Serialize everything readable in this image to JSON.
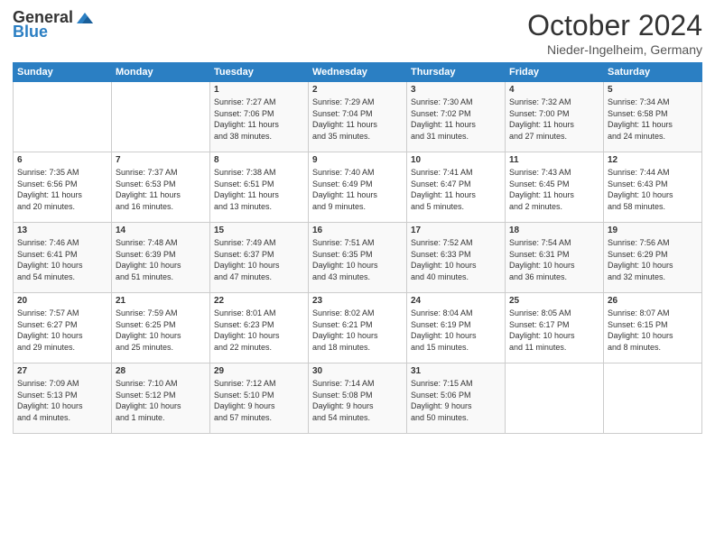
{
  "header": {
    "logo_general": "General",
    "logo_blue": "Blue",
    "month_title": "October 2024",
    "location": "Nieder-Ingelheim, Germany"
  },
  "days_of_week": [
    "Sunday",
    "Monday",
    "Tuesday",
    "Wednesday",
    "Thursday",
    "Friday",
    "Saturday"
  ],
  "weeks": [
    {
      "days": [
        {
          "num": "",
          "detail": ""
        },
        {
          "num": "",
          "detail": ""
        },
        {
          "num": "1",
          "detail": "Sunrise: 7:27 AM\nSunset: 7:06 PM\nDaylight: 11 hours\nand 38 minutes."
        },
        {
          "num": "2",
          "detail": "Sunrise: 7:29 AM\nSunset: 7:04 PM\nDaylight: 11 hours\nand 35 minutes."
        },
        {
          "num": "3",
          "detail": "Sunrise: 7:30 AM\nSunset: 7:02 PM\nDaylight: 11 hours\nand 31 minutes."
        },
        {
          "num": "4",
          "detail": "Sunrise: 7:32 AM\nSunset: 7:00 PM\nDaylight: 11 hours\nand 27 minutes."
        },
        {
          "num": "5",
          "detail": "Sunrise: 7:34 AM\nSunset: 6:58 PM\nDaylight: 11 hours\nand 24 minutes."
        }
      ]
    },
    {
      "days": [
        {
          "num": "6",
          "detail": "Sunrise: 7:35 AM\nSunset: 6:56 PM\nDaylight: 11 hours\nand 20 minutes."
        },
        {
          "num": "7",
          "detail": "Sunrise: 7:37 AM\nSunset: 6:53 PM\nDaylight: 11 hours\nand 16 minutes."
        },
        {
          "num": "8",
          "detail": "Sunrise: 7:38 AM\nSunset: 6:51 PM\nDaylight: 11 hours\nand 13 minutes."
        },
        {
          "num": "9",
          "detail": "Sunrise: 7:40 AM\nSunset: 6:49 PM\nDaylight: 11 hours\nand 9 minutes."
        },
        {
          "num": "10",
          "detail": "Sunrise: 7:41 AM\nSunset: 6:47 PM\nDaylight: 11 hours\nand 5 minutes."
        },
        {
          "num": "11",
          "detail": "Sunrise: 7:43 AM\nSunset: 6:45 PM\nDaylight: 11 hours\nand 2 minutes."
        },
        {
          "num": "12",
          "detail": "Sunrise: 7:44 AM\nSunset: 6:43 PM\nDaylight: 10 hours\nand 58 minutes."
        }
      ]
    },
    {
      "days": [
        {
          "num": "13",
          "detail": "Sunrise: 7:46 AM\nSunset: 6:41 PM\nDaylight: 10 hours\nand 54 minutes."
        },
        {
          "num": "14",
          "detail": "Sunrise: 7:48 AM\nSunset: 6:39 PM\nDaylight: 10 hours\nand 51 minutes."
        },
        {
          "num": "15",
          "detail": "Sunrise: 7:49 AM\nSunset: 6:37 PM\nDaylight: 10 hours\nand 47 minutes."
        },
        {
          "num": "16",
          "detail": "Sunrise: 7:51 AM\nSunset: 6:35 PM\nDaylight: 10 hours\nand 43 minutes."
        },
        {
          "num": "17",
          "detail": "Sunrise: 7:52 AM\nSunset: 6:33 PM\nDaylight: 10 hours\nand 40 minutes."
        },
        {
          "num": "18",
          "detail": "Sunrise: 7:54 AM\nSunset: 6:31 PM\nDaylight: 10 hours\nand 36 minutes."
        },
        {
          "num": "19",
          "detail": "Sunrise: 7:56 AM\nSunset: 6:29 PM\nDaylight: 10 hours\nand 32 minutes."
        }
      ]
    },
    {
      "days": [
        {
          "num": "20",
          "detail": "Sunrise: 7:57 AM\nSunset: 6:27 PM\nDaylight: 10 hours\nand 29 minutes."
        },
        {
          "num": "21",
          "detail": "Sunrise: 7:59 AM\nSunset: 6:25 PM\nDaylight: 10 hours\nand 25 minutes."
        },
        {
          "num": "22",
          "detail": "Sunrise: 8:01 AM\nSunset: 6:23 PM\nDaylight: 10 hours\nand 22 minutes."
        },
        {
          "num": "23",
          "detail": "Sunrise: 8:02 AM\nSunset: 6:21 PM\nDaylight: 10 hours\nand 18 minutes."
        },
        {
          "num": "24",
          "detail": "Sunrise: 8:04 AM\nSunset: 6:19 PM\nDaylight: 10 hours\nand 15 minutes."
        },
        {
          "num": "25",
          "detail": "Sunrise: 8:05 AM\nSunset: 6:17 PM\nDaylight: 10 hours\nand 11 minutes."
        },
        {
          "num": "26",
          "detail": "Sunrise: 8:07 AM\nSunset: 6:15 PM\nDaylight: 10 hours\nand 8 minutes."
        }
      ]
    },
    {
      "days": [
        {
          "num": "27",
          "detail": "Sunrise: 7:09 AM\nSunset: 5:13 PM\nDaylight: 10 hours\nand 4 minutes."
        },
        {
          "num": "28",
          "detail": "Sunrise: 7:10 AM\nSunset: 5:12 PM\nDaylight: 10 hours\nand 1 minute."
        },
        {
          "num": "29",
          "detail": "Sunrise: 7:12 AM\nSunset: 5:10 PM\nDaylight: 9 hours\nand 57 minutes."
        },
        {
          "num": "30",
          "detail": "Sunrise: 7:14 AM\nSunset: 5:08 PM\nDaylight: 9 hours\nand 54 minutes."
        },
        {
          "num": "31",
          "detail": "Sunrise: 7:15 AM\nSunset: 5:06 PM\nDaylight: 9 hours\nand 50 minutes."
        },
        {
          "num": "",
          "detail": ""
        },
        {
          "num": "",
          "detail": ""
        }
      ]
    }
  ]
}
